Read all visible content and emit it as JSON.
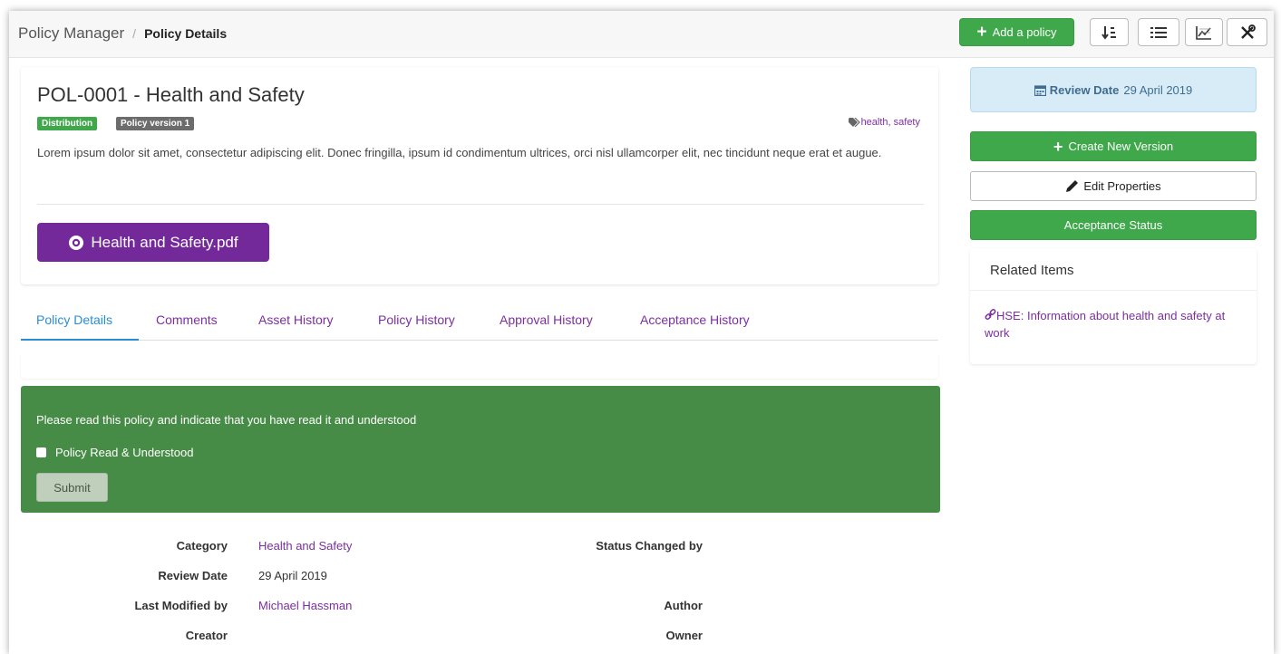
{
  "breadcrumb": {
    "root": "Policy Manager",
    "separator": "/",
    "current": "Policy Details"
  },
  "toolbar": {
    "add_label": "Add a policy",
    "icons": [
      "sort-icon",
      "list-icon",
      "chart-icon",
      "tools-icon"
    ]
  },
  "policy": {
    "title": "POL-0001 - Health and Safety",
    "badges": {
      "distribution": "Distribution",
      "version": "Policy version 1"
    },
    "tags": "health, safety",
    "description": "Lorem ipsum dolor sit amet, consectetur adipiscing elit. Donec fringilla, ipsum id condimentum ultrices, orci nisl ullamcorper elit, nec tincidunt neque erat et augue.",
    "file_label": "Health and Safety.pdf"
  },
  "tabs": [
    "Policy Details",
    "Comments",
    "Asset History",
    "Policy History",
    "Approval History",
    "Acceptance History"
  ],
  "acceptance": {
    "prompt": "Please read this policy and indicate that you have read it and understood",
    "checkbox_label": "Policy Read & Understood",
    "submit_label": "Submit"
  },
  "details": {
    "category_label": "Category",
    "category_value": "Health and Safety",
    "review_label": "Review Date",
    "review_value": "29 April 2019",
    "modified_label": "Last Modified by",
    "modified_value": "Michael Hassman",
    "creator_label": "Creator",
    "status_changed_label": "Status Changed by",
    "author_label": "Author",
    "owner_label": "Owner"
  },
  "sidebar": {
    "review_label": "Review Date",
    "review_value": "29 April 2019",
    "create_label": "Create New Version",
    "edit_label": "Edit Properties",
    "acceptance_label": "Acceptance Status",
    "related_title": "Related Items",
    "related_link": "HSE: Information about health and safety at work"
  },
  "colors": {
    "green": "#3fa84b",
    "purple": "#74299a",
    "panel_green": "#478c46",
    "link_purple": "#7b2fa0",
    "active_blue": "#2a8dd4"
  }
}
